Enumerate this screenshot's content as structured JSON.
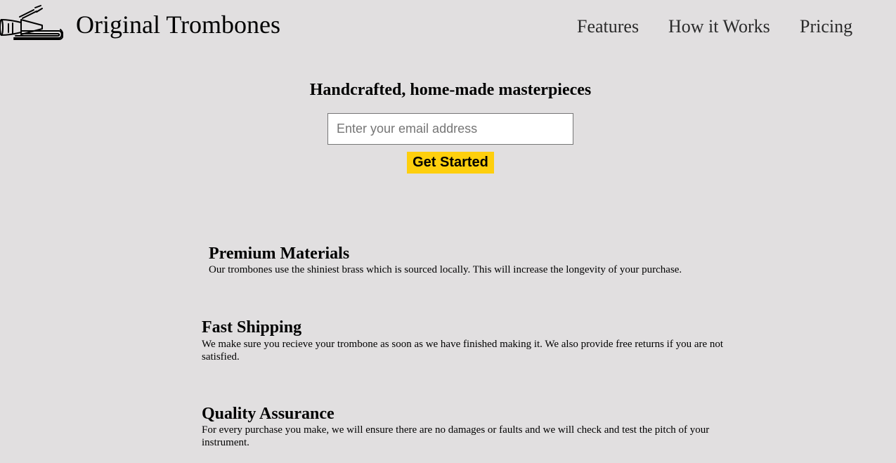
{
  "header": {
    "logo_icon": "trombone-icon",
    "brand": "Original Trombones",
    "nav": [
      {
        "label": "Features"
      },
      {
        "label": "How it Works"
      },
      {
        "label": "Pricing"
      }
    ]
  },
  "hero": {
    "title": "Handcrafted, home-made masterpieces",
    "email_placeholder": "Enter your email address",
    "email_value": "",
    "cta_label": "Get Started",
    "cta_color": "#fecf0d"
  },
  "features": [
    {
      "title": "Premium Materials",
      "text": "Our trombones use the shiniest brass which is sourced locally. This will increase the longevity of your purchase."
    },
    {
      "title": "Fast Shipping",
      "text": "We make sure you recieve your trombone as soon as we have finished making it. We also provide free returns if you are not satisfied."
    },
    {
      "title": "Quality Assurance",
      "text": "For every purchase you make, we will ensure there are no damages or faults and we will check and test the pitch of your instrument."
    }
  ],
  "colors": {
    "background": "#e1dfe0",
    "accent": "#fecf0d"
  }
}
